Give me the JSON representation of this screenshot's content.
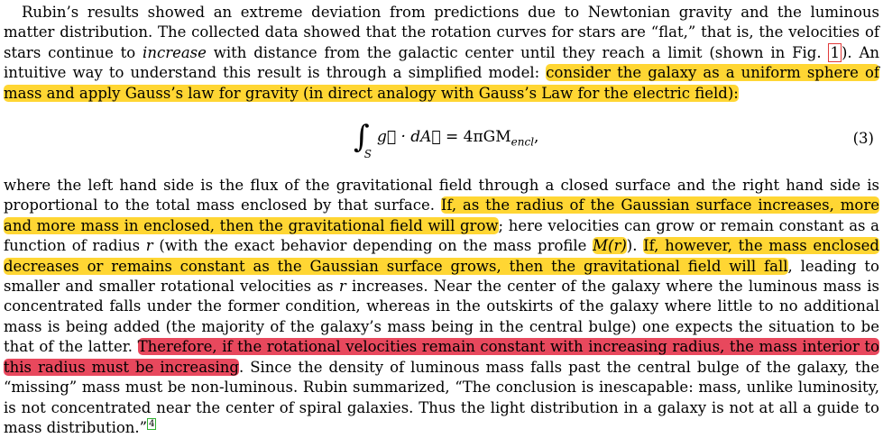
{
  "para1": {
    "s1": "Rubin’s results showed an extreme deviation from predictions due to Newtonian gravity and the luminous matter distribution. The collected data showed that the rotation curves for stars are “flat,” that is, the velocities of stars continue to ",
    "s1_em": "increase",
    "s2": " with distance from the galactic center until they reach a limit (shown in Fig. ",
    "fig_ref": "1",
    "s3": "). An intuitive way to understand this result is through a simplified model: ",
    "hl1": "consider the galaxy as a uniform sphere of mass and apply Gauss’s law for gravity (in direct analogy with Gauss’s Law for the electric field):"
  },
  "equation": {
    "integral_sub": "S",
    "lhs": "g⃗ · dA⃗",
    "eq": " = 4πGM",
    "rhs_sub": "encl",
    "end": ",",
    "number": "(3)"
  },
  "para2": {
    "s1": "where the left hand side is the flux of the gravitational field through a closed surface and the right hand side is proportional to the total mass enclosed by that surface. ",
    "hl2": "If, as the radius of the Gaussian surface increases, more and more mass in enclosed, then the gravitational field will grow",
    "s2": "; here velocities can grow or remain constant as a function of radius ",
    "var_r": "r",
    "s3": " (with the exact behavior depending on the mass profile ",
    "mass_profile": "M(r)",
    "s4": "). ",
    "hl3": "If, however, the mass enclosed decreases or remains constant as the Gaussian surface grows, then the gravitational field will fall",
    "s5": ", leading to smaller and smaller rotational velocities as ",
    "var_r2": "r",
    "s6": " increases. Near the center of the galaxy where the luminous mass is concentrated falls under the former condition, whereas in the outskirts of the galaxy where little to no additional mass is being added (the majority of the galaxy’s mass being in the central bulge) one expects the situation to be that of the latter. ",
    "hl4": "Therefore, if the rotational velocities remain constant with increasing radius, the mass interior to this radius must be increasing",
    "s7": ". Since the density of luminous mass falls past the central bulge of the galaxy, the “missing” mass must be non-luminous. Rubin summarized, “The conclusion is inescapable: mass, unlike luminosity, is not concentrated near the center of spiral galaxies. Thus the light distribution in a galaxy is not at all a guide to mass distribution.”",
    "cite": "4"
  },
  "colors": {
    "highlight_yellow": "#ffd633",
    "highlight_red": "#e8485d",
    "ref_box": "#e03a3a",
    "cite_box": "#2fae2f"
  }
}
